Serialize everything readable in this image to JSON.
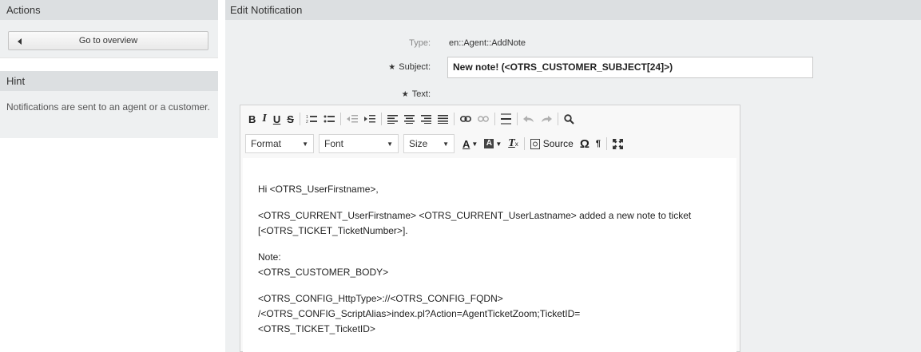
{
  "sidebar": {
    "actions_title": "Actions",
    "overview_button": "Go to overview",
    "hint_title": "Hint",
    "hint_text": "Notifications are sent to an agent or a customer."
  },
  "main": {
    "header": "Edit Notification",
    "type_label": "Type:",
    "type_value": "en::Agent::AddNote",
    "subject_label": "Subject:",
    "subject_value": "New note! (<OTRS_CUSTOMER_SUBJECT[24]>)",
    "text_label": "Text:",
    "required_marker": "★"
  },
  "editor": {
    "toolbar_row1": [
      {
        "name": "bold-button",
        "glyph": "B"
      },
      {
        "name": "italic-button",
        "glyph": "I"
      },
      {
        "name": "underline-button",
        "glyph": "U"
      },
      {
        "name": "strikethrough-button",
        "glyph": "S"
      }
    ],
    "format_label": "Format",
    "font_label": "Font",
    "size_label": "Size",
    "source_label": "Source",
    "body_lines": [
      "Hi <OTRS_UserFirstname>,",
      "<OTRS_CURRENT_UserFirstname> <OTRS_CURRENT_UserLastname> added a new note to ticket",
      "[<OTRS_TICKET_TicketNumber>].",
      "Note:",
      "<OTRS_CUSTOMER_BODY>",
      "<OTRS_CONFIG_HttpType>://<OTRS_CONFIG_FQDN>",
      "/<OTRS_CONFIG_ScriptAlias>index.pl?Action=AgentTicketZoom;TicketID=",
      "<OTRS_TICKET_TicketID>"
    ]
  }
}
